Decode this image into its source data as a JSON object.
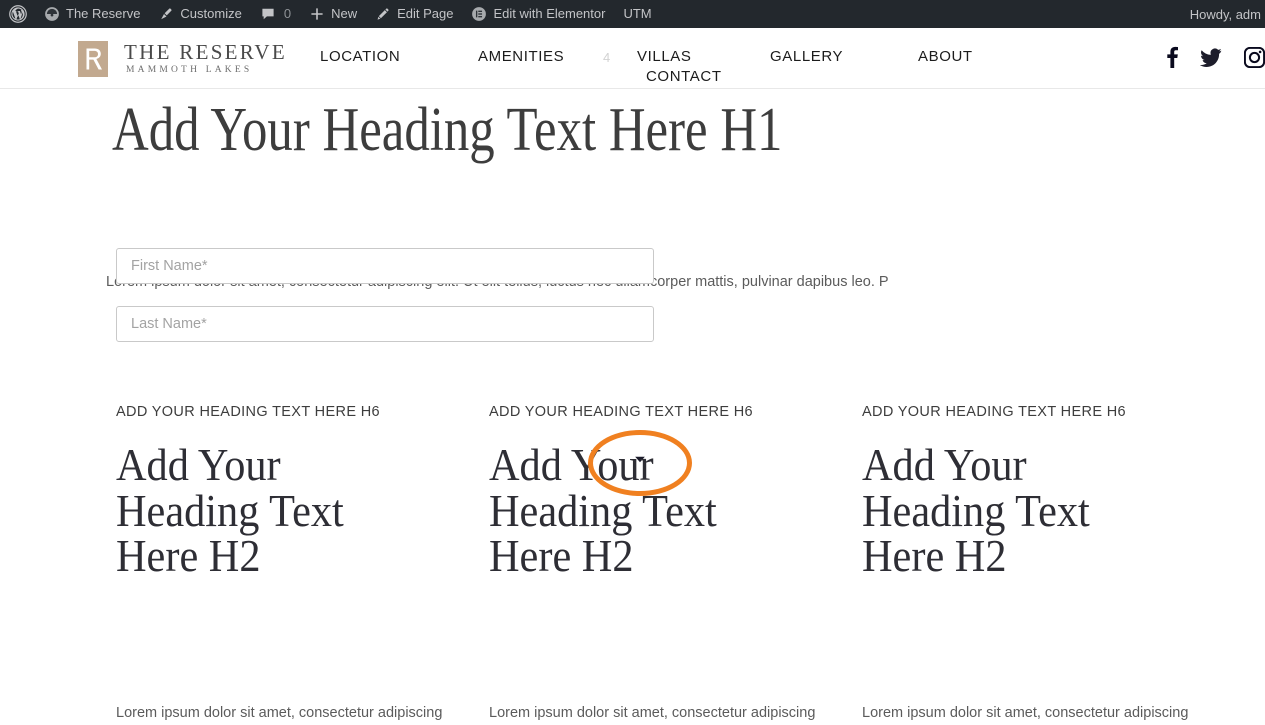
{
  "admin_bar": {
    "items": [
      {
        "icon": "wordpress-logo-icon",
        "label": ""
      },
      {
        "icon": "dashboard-icon",
        "label": "The Reserve"
      },
      {
        "icon": "brush-icon",
        "label": "Customize"
      },
      {
        "icon": "comment-bubble-icon",
        "label": "",
        "count": "0"
      },
      {
        "icon": "plus-icon",
        "label": "New"
      },
      {
        "icon": "pencil-icon",
        "label": "Edit Page"
      },
      {
        "icon": "elementor-icon",
        "label": "Edit with Elementor"
      },
      {
        "icon": "",
        "label": "UTM"
      }
    ],
    "howdy": "Howdy, adm"
  },
  "header": {
    "logo": {
      "mark_letter": "R",
      "title": "THE RESERVE",
      "subtitle": "MAMMOTH LAKES",
      "mark_color": "#c2a98f"
    },
    "nav": [
      {
        "label": "LOCATION"
      },
      {
        "label": "AMENITIES"
      },
      {
        "label": "VILLAS"
      },
      {
        "label": "CONTACT"
      },
      {
        "label": "GALLERY"
      },
      {
        "label": "ABOUT"
      }
    ],
    "nav_ghost_marker": "4",
    "social": [
      {
        "icon": "facebook-icon"
      },
      {
        "icon": "twitter-icon"
      },
      {
        "icon": "instagram-icon"
      }
    ]
  },
  "main": {
    "h1": "Add Your Heading Text Here H1",
    "intro_paragraph": "Lorem ipsum dolor sit amet, consectetur adipiscing elit. Ut elit tellus, luctus nec ullamcorper mattis, pulvinar dapibus leo. P",
    "form": {
      "first_name": {
        "placeholder": "First Name*",
        "value": ""
      },
      "last_name": {
        "placeholder": "Last Name*",
        "value": ""
      },
      "dropdown_caret": "select-caret-icon"
    },
    "annotation": {
      "shape": "ellipse",
      "color": "#f08020",
      "target": "select-dropdown-caret"
    },
    "columns": [
      {
        "h6": "ADD YOUR HEADING TEXT HERE H6",
        "h2": "Add Your Heading Text Here H2",
        "paragraph": "Lorem ipsum dolor sit amet, consectetur adipiscing"
      },
      {
        "h6": "ADD YOUR HEADING TEXT HERE H6",
        "h2": "Add Your Heading Text Here H2",
        "paragraph": "Lorem ipsum dolor sit amet, consectetur adipiscing"
      },
      {
        "h6": "ADD YOUR HEADING TEXT HERE H6",
        "h2": "Add Your Heading Text Here H2",
        "paragraph": "Lorem ipsum dolor sit amet, consectetur adipiscing"
      }
    ]
  }
}
